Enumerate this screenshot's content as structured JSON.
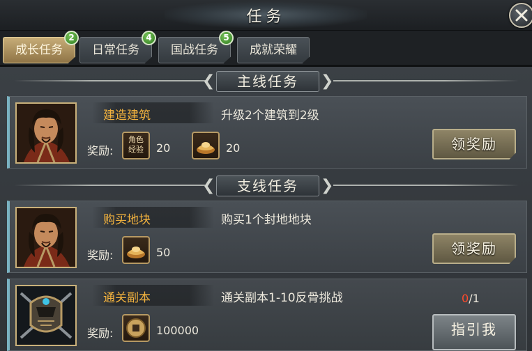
{
  "window": {
    "title": "任务"
  },
  "tabs": [
    {
      "label": "成长任务",
      "badge": "2",
      "active": true
    },
    {
      "label": "日常任务",
      "badge": "4",
      "active": false
    },
    {
      "label": "国战任务",
      "badge": "5",
      "active": false
    },
    {
      "label": "成就荣耀",
      "badge": null,
      "active": false
    }
  ],
  "sections": {
    "main": {
      "title": "主线任务"
    },
    "side": {
      "title": "支线任务"
    }
  },
  "quests": [
    {
      "name": "建造建筑",
      "description": "升级2个建筑到2级",
      "reward_label": "奖励:",
      "rewards": [
        {
          "icon": "role-exp-icon",
          "icon_text": "角色经验",
          "value": "20"
        },
        {
          "icon": "gold-ingot-icon",
          "value": "20"
        }
      ],
      "action_label": "领奖励"
    },
    {
      "name": "购买地块",
      "description": "购买1个封地地块",
      "reward_label": "奖励:",
      "rewards": [
        {
          "icon": "gold-ingot-icon",
          "value": "50"
        }
      ],
      "action_label": "领奖励"
    },
    {
      "name": "通关副本",
      "description": "通关副本1-10反骨挑战",
      "reward_label": "奖励:",
      "rewards": [
        {
          "icon": "copper-coin-icon",
          "value": "100000"
        }
      ],
      "progress_current": "0",
      "progress_total": "/1",
      "action_label": "指引我"
    }
  ],
  "colors": {
    "accent_gold": "#f2b23e",
    "badge_green": "#4c9e35",
    "progress_red": "#ff4a2c",
    "card_edge": "#7ab3c2"
  }
}
